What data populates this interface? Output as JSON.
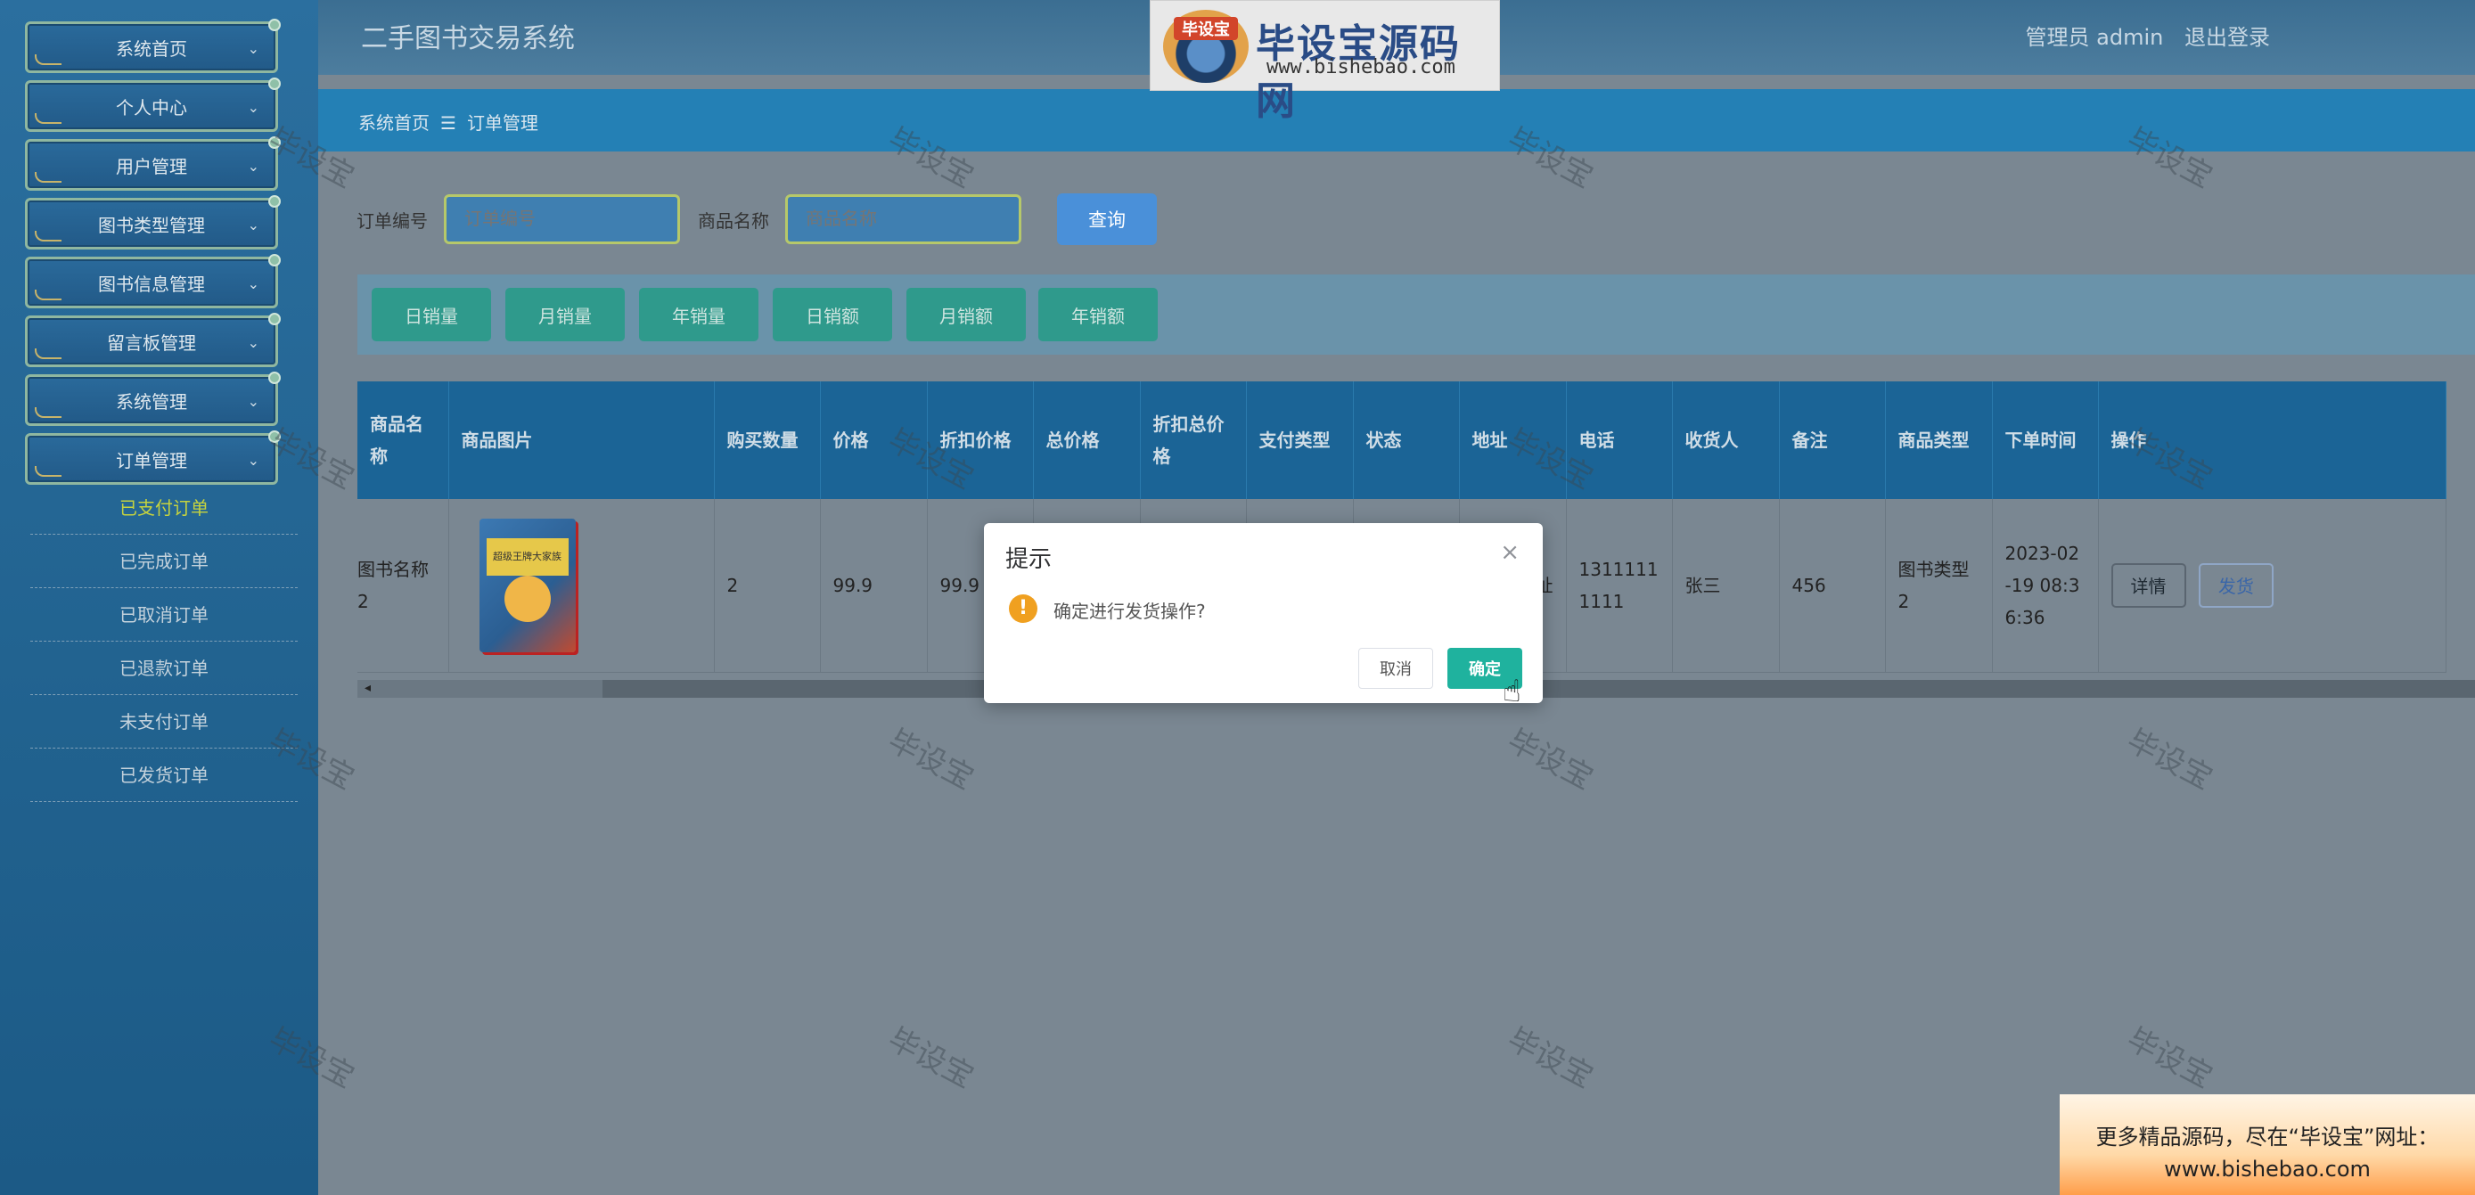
{
  "sidebar": {
    "menu": [
      "系统首页",
      "个人中心",
      "用户管理",
      "图书类型管理",
      "图书信息管理",
      "留言板管理",
      "系统管理",
      "订单管理"
    ],
    "submenu": [
      "已支付订单",
      "已完成订单",
      "已取消订单",
      "已退款订单",
      "未支付订单",
      "已发货订单"
    ],
    "active_sub": "已支付订单"
  },
  "header": {
    "title": "二手图书交易系统",
    "user": "管理员 admin",
    "logout": "退出登录"
  },
  "logo": {
    "badge": "毕设宝",
    "name": "毕设宝源码网",
    "url": "www.bishebao.com"
  },
  "breadcrumb": {
    "home": "系统首页",
    "sep": "☰",
    "current": "订单管理"
  },
  "search": {
    "order_no_label": "订单编号",
    "order_no_placeholder": "订单编号",
    "product_label": "商品名称",
    "product_placeholder": "商品名称",
    "query_button": "查询"
  },
  "stats_buttons": [
    "日销量",
    "月销量",
    "年销量",
    "日销额",
    "月销额",
    "年销额"
  ],
  "table": {
    "headers": [
      "商品名称",
      "商品图片",
      "购买数量",
      "价格",
      "折扣价格",
      "总价格",
      "折扣总价格",
      "支付类型",
      "状态",
      "地址",
      "电话",
      "收货人",
      "备注",
      "商品类型",
      "下单时间",
      "操作"
    ],
    "row": {
      "name": "图书名称2",
      "image_title": "超级王牌大家族",
      "qty": "2",
      "price": "99.9",
      "discount_price": "99.9",
      "address": "址",
      "phone": "13111111111",
      "receiver": "张三",
      "remark": "456",
      "type": "图书类型2",
      "time": "2023-02-19 08:36:36",
      "detail_btn": "详情",
      "ship_btn": "发货"
    }
  },
  "dialog": {
    "title": "提示",
    "message": "确定进行发货操作?",
    "cancel": "取消",
    "confirm": "确定"
  },
  "watermark": "毕设宝",
  "promo": {
    "line1": "更多精品源码，尽在“毕设宝”网址：",
    "line2": "www.bishebao.com"
  },
  "colors": {
    "sidebar": "#2b6f9f",
    "breadcrumb": "#2480b5",
    "stat_button": "#2f9a8c",
    "confirm": "#1fb29e",
    "warning": "#f0a020"
  }
}
